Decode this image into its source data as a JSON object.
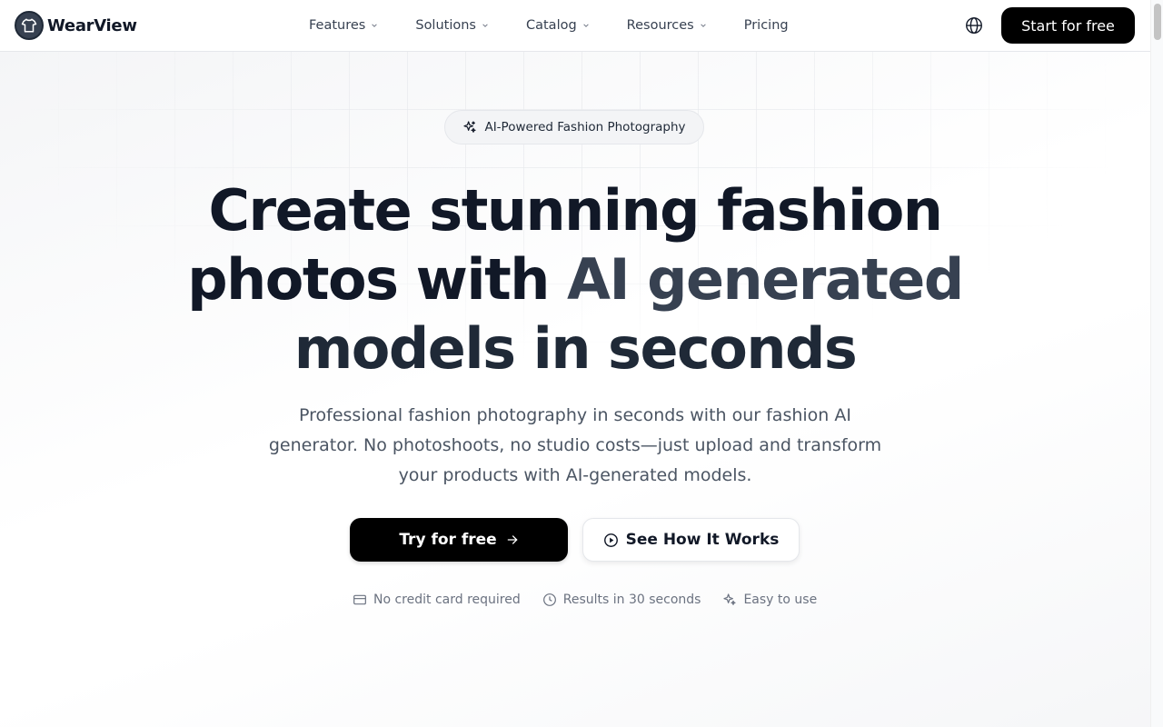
{
  "brand": {
    "name": "WearView"
  },
  "nav": {
    "items": [
      {
        "label": "Features",
        "dropdown": true
      },
      {
        "label": "Solutions",
        "dropdown": true
      },
      {
        "label": "Catalog",
        "dropdown": true
      },
      {
        "label": "Resources",
        "dropdown": true
      },
      {
        "label": "Pricing",
        "dropdown": false
      }
    ],
    "globe_icon": "globe-icon",
    "cta_label": "Start for free"
  },
  "hero": {
    "badge": {
      "icon": "sparkles-icon",
      "label": "AI-Powered Fashion Photography"
    },
    "headline": {
      "line1": "Create stunning fashion",
      "line2_start": "photos with ",
      "line2_accent": "AI generated",
      "line3": "models in seconds"
    },
    "subtext": "Professional fashion photography in seconds with our fashion AI generator. No photoshoots, no studio costs—just upload and transform your products with AI-generated models.",
    "primary_cta": {
      "label": "Try for free",
      "icon": "arrow-right-icon"
    },
    "secondary_cta": {
      "label": "See How It Works",
      "icon": "play-circle-icon"
    },
    "perks": [
      {
        "icon": "credit-card-icon",
        "label": "No credit card required"
      },
      {
        "icon": "clock-icon",
        "label": "Results in 30 seconds"
      },
      {
        "icon": "sparkles-icon",
        "label": "Easy to use"
      }
    ]
  },
  "colors": {
    "primary": "#000000",
    "text": "#111827",
    "muted": "#6b7280",
    "border": "#e5e7eb"
  }
}
